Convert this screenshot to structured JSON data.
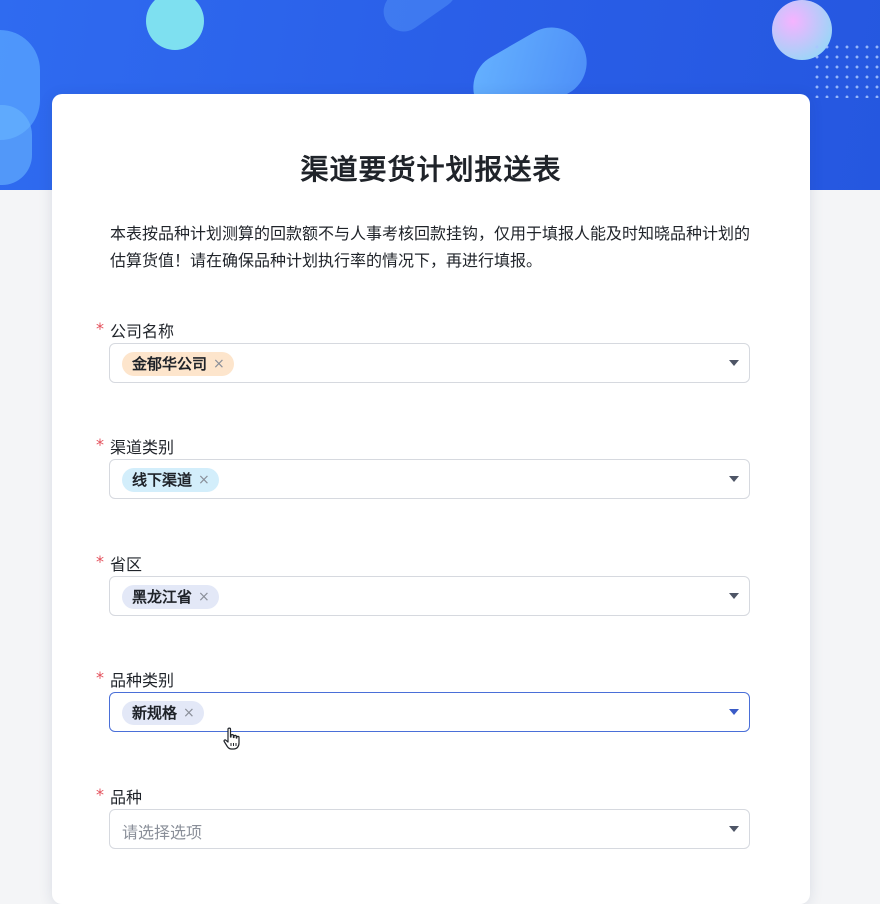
{
  "form": {
    "title": "渠道要货计划报送表",
    "description": "本表按品种计划测算的回款额不与人事考核回款挂钩，仅用于填报人能及时知晓品种计划的估算货值！请在确保品种计划执行率的情况下，再进行填报。",
    "required_mark": "*",
    "fields": [
      {
        "label": "公司名称",
        "tag": "金郁华公司",
        "tag_color": "#fde5cc"
      },
      {
        "label": "渠道类别",
        "tag": "线下渠道",
        "tag_color": "#d3eefb"
      },
      {
        "label": "省区",
        "tag": "黑龙江省",
        "tag_color": "#e3e8f7"
      },
      {
        "label": "品种类别",
        "tag": "新规格",
        "tag_color": "#e3e8f7"
      },
      {
        "label": "品种",
        "placeholder": "请选择选项"
      }
    ],
    "tag_remove_glyph": "×"
  },
  "colors": {
    "banner": "#2a5fe8",
    "required": "#e34d59",
    "active_border": "#4a6fd8"
  },
  "icons": {
    "dropdown": "caret-down-icon",
    "cursor": "hand-pointer-icon",
    "remove": "close-icon"
  }
}
